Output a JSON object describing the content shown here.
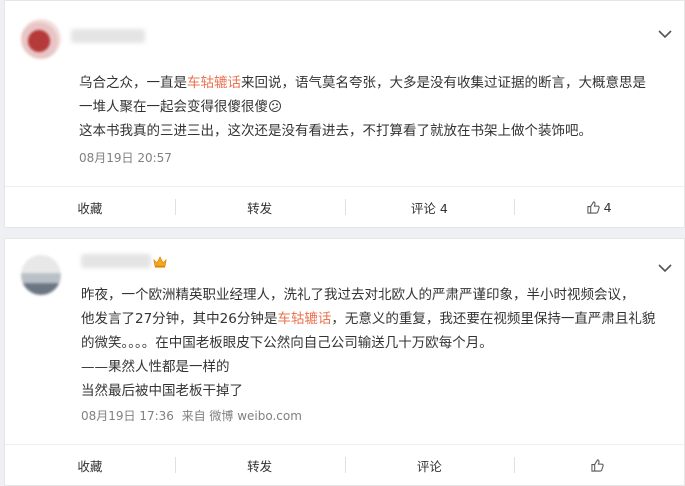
{
  "comments": [
    {
      "lines": [
        [
          "乌合之众，一直是",
          "车轱辘话",
          "来回说，语气莫名夸张，大多是没有收集过证据的断言，大概意思是"
        ],
        [
          "一堆人聚在一起会变得很傻很傻😕"
        ],
        [
          "这本书我真的三进三出，这次还是没有看进去，不打算看了就放在书架上做个装饰吧。"
        ]
      ],
      "date": "08月19日 20:57",
      "source": "",
      "actions": {
        "collect": "收藏",
        "repost": "转发",
        "comment": "评论 4",
        "like": "4"
      }
    },
    {
      "lines": [
        [
          "昨夜，一个欧洲精英职业经理人，洗礼了我过去对北欧人的严肃严谨印象，半小时视频会议，"
        ],
        [
          "他发言了27分钟，其中26分钟是",
          "车轱辘话",
          "，无意义的重复，我还要在视频里保持一直严肃且礼貌"
        ],
        [
          "的微笑。。。。在中国老板眼皮下公然向自己公司输送几十万欧每个月。"
        ],
        [
          "——果然人性都是一样的"
        ],
        [
          "当然最后被中国老板干掉了"
        ]
      ],
      "date": "08月19日 17:36",
      "source": "来自 微博 weibo.com",
      "actions": {
        "collect": "收藏",
        "repost": "转发",
        "comment": "评论",
        "like": ""
      }
    }
  ],
  "colors": {
    "highlight": "#eb7350",
    "meta": "#808080",
    "background": "#eef0f3"
  },
  "icons": {
    "expand": "chevron-down-icon",
    "like": "thumbs-up-icon",
    "badge": "crown-icon"
  }
}
